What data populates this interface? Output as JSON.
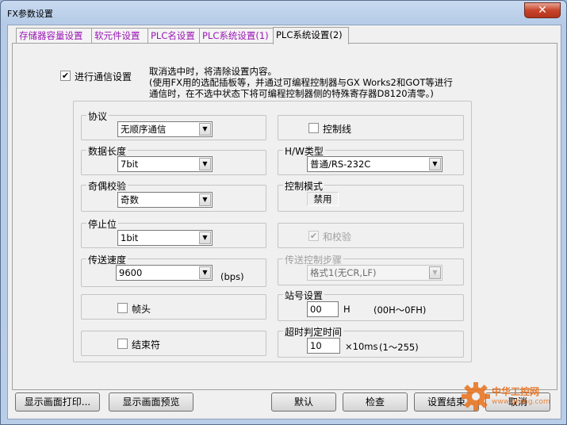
{
  "window": {
    "title": "FX参数设置",
    "close_glyph": "✕"
  },
  "tabs": [
    {
      "label": "存储器容量设置"
    },
    {
      "label": "软元件设置"
    },
    {
      "label": "PLC名设置"
    },
    {
      "label": "PLC系统设置(1)"
    },
    {
      "label": "PLC系统设置(2)",
      "active": true
    }
  ],
  "comm": {
    "enable_label": "进行通信设置",
    "enable_checked": true,
    "note_line1": "取消选中时，将清除设置内容。",
    "note_line2": "(使用FX用的选配插板等，并通过可编程控制器与GX Works2和GOT等进行",
    "note_line3": "通信时，在不选中状态下将可编程控制器侧的特殊寄存器D8120清零。)"
  },
  "protocol": {
    "label": "协议",
    "value": "无顺序通信"
  },
  "data_length": {
    "label": "数据长度",
    "value": "7bit"
  },
  "parity": {
    "label": "奇偶校验",
    "value": "奇数"
  },
  "stop_bit": {
    "label": "停止位",
    "value": "1bit"
  },
  "baud": {
    "label": "传送速度",
    "value": "9600",
    "unit": "(bps)"
  },
  "header": {
    "label": "帧头",
    "checked": false
  },
  "terminator": {
    "label": "结束符",
    "checked": false
  },
  "control_line": {
    "label": "控制线",
    "checked": false
  },
  "hw_type": {
    "label": "H/W类型",
    "value": "普通/RS-232C"
  },
  "control_mode": {
    "label": "控制模式",
    "value": "禁用"
  },
  "sum_check": {
    "label": "和校验",
    "checked": true,
    "disabled": true
  },
  "transfer_step": {
    "label": "传送控制步骤",
    "value": "格式1(无CR,LF)",
    "disabled": true
  },
  "station": {
    "label": "站号设置",
    "value": "00",
    "suffix": "H",
    "range": "(00H～0FH)"
  },
  "timeout": {
    "label": "超时判定时间",
    "value": "10",
    "unit": "×10ms",
    "range": "(1～255)"
  },
  "buttons": {
    "print": "显示画面打印...",
    "preview": "显示画面预览",
    "default": "默认",
    "check": "检查",
    "finish": "设置结束",
    "cancel": "取消"
  },
  "watermark": {
    "line1": "中华工控网",
    "line2": "www.gkong.com"
  },
  "colors": {
    "tab_text": "#9a16b5",
    "accent": "#e8701a"
  }
}
